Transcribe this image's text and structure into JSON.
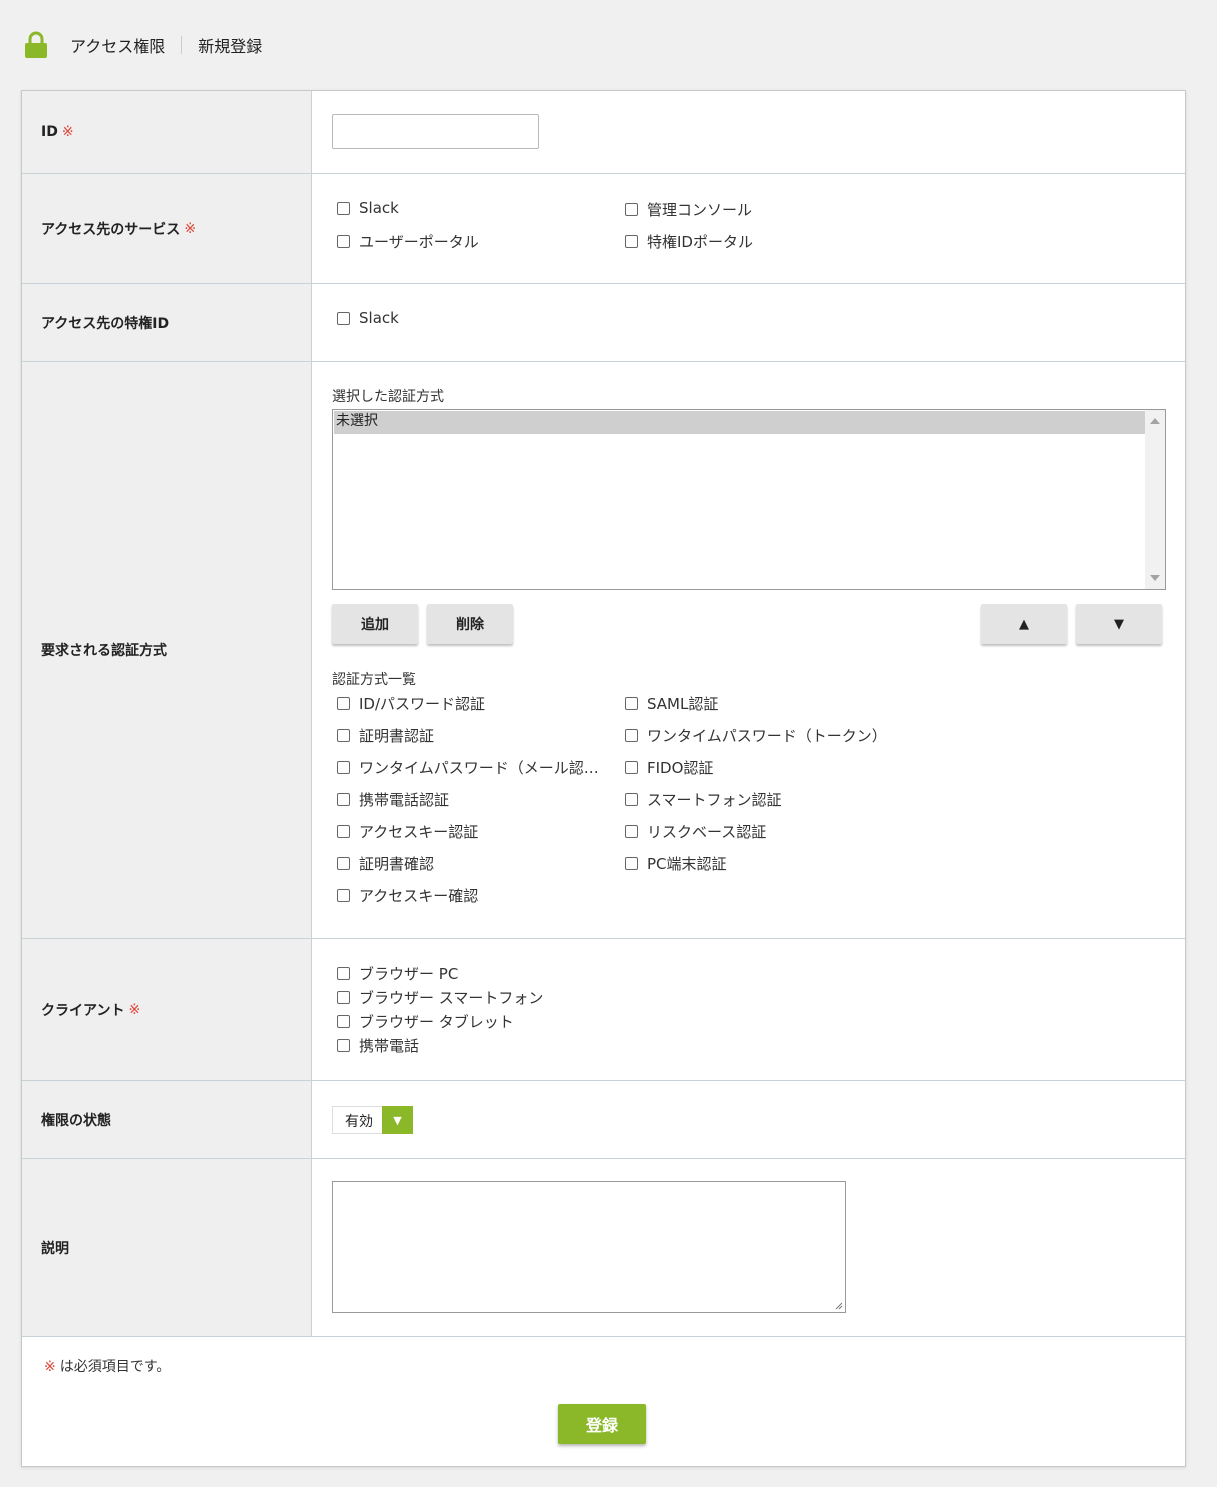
{
  "breadcrumb": {
    "section": "アクセス権限",
    "page": "新規登録"
  },
  "required_mark": "※",
  "fields": {
    "id": {
      "label": "ID",
      "value": ""
    },
    "services": {
      "label": "アクセス先のサービス",
      "options": [
        "Slack",
        "管理コンソール",
        "ユーザーポータル",
        "特権IDポータル"
      ]
    },
    "privileged_id": {
      "label": "アクセス先の特権ID",
      "options": [
        "Slack"
      ]
    },
    "auth": {
      "label": "要求される認証方式",
      "selected_caption": "選択した認証方式",
      "selected_items": [
        "未選択"
      ],
      "add_label": "追加",
      "delete_label": "削除",
      "up_label": "▲",
      "down_label": "▼",
      "list_caption": "認証方式一覧",
      "methods": [
        "ID/パスワード認証",
        "SAML認証",
        "証明書認証",
        "ワンタイムパスワード（トークン）",
        "ワンタイムパスワード（メール認…",
        "FIDO認証",
        "携帯電話認証",
        "スマートフォン認証",
        "アクセスキー認証",
        "リスクベース認証",
        "証明書確認",
        "PC端末認証",
        "アクセスキー確認"
      ]
    },
    "client": {
      "label": "クライアント",
      "options": [
        "ブラウザー PC",
        "ブラウザー スマートフォン",
        "ブラウザー タブレット",
        "携帯電話"
      ]
    },
    "status": {
      "label": "権限の状態",
      "value": "有効"
    },
    "description": {
      "label": "説明",
      "value": ""
    }
  },
  "footer": {
    "note": "は必須項目です。",
    "submit_label": "登録"
  },
  "colors": {
    "accent": "#8ab829",
    "required": "#e0453a"
  },
  "icons": {
    "header": "lock-icon"
  }
}
